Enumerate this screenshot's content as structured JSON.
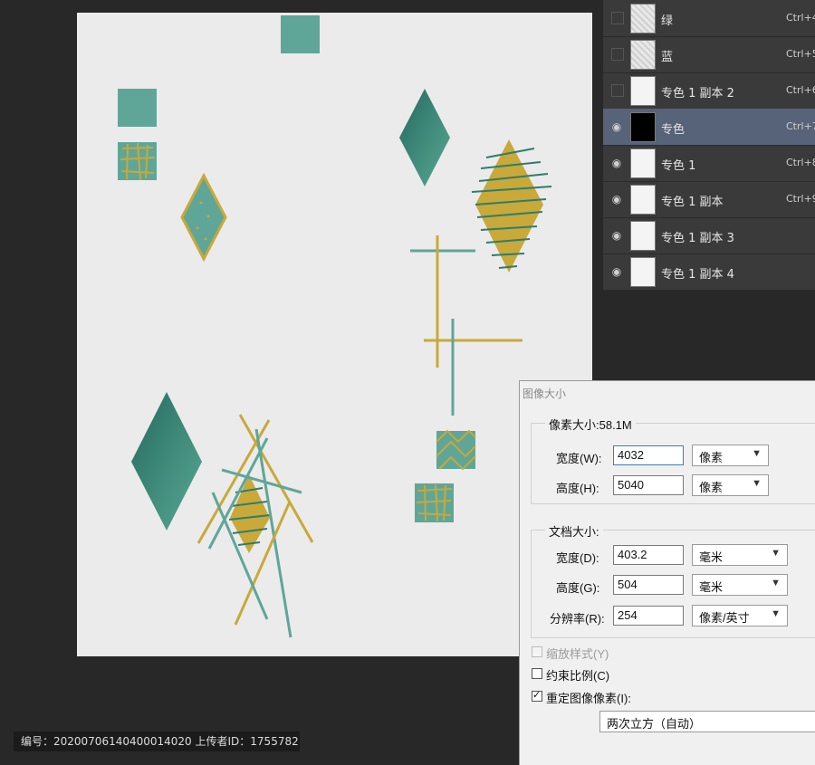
{
  "layers": [
    {
      "name": "绿",
      "shortcut": "Ctrl+4",
      "visible": false,
      "thumb": "tex"
    },
    {
      "name": "蓝",
      "shortcut": "Ctrl+5",
      "visible": false,
      "thumb": "tex"
    },
    {
      "name": "专色 1 副本 2",
      "shortcut": "Ctrl+6",
      "visible": false,
      "thumb": "white"
    },
    {
      "name": "专色",
      "shortcut": "Ctrl+7",
      "visible": true,
      "active": true,
      "thumb": "black"
    },
    {
      "name": "专色 1",
      "shortcut": "Ctrl+8",
      "visible": true,
      "thumb": "white"
    },
    {
      "name": "专色 1 副本",
      "shortcut": "Ctrl+9",
      "visible": true,
      "thumb": "white"
    },
    {
      "name": "专色 1 副本 3",
      "shortcut": "",
      "visible": true,
      "thumb": "white"
    },
    {
      "name": "专色 1 副本 4",
      "shortcut": "",
      "visible": true,
      "thumb": "white"
    }
  ],
  "dialog": {
    "title": "图像大小",
    "pixel_size_label": "像素大小:58.1M",
    "width_label": "宽度(W):",
    "width_value": "4032",
    "width_unit": "像素",
    "height_label": "高度(H):",
    "height_value": "5040",
    "height_unit": "像素",
    "doc_size_label": "文档大小:",
    "doc_width_label": "宽度(D):",
    "doc_width_value": "403.2",
    "doc_width_unit": "毫米",
    "doc_height_label": "高度(G):",
    "doc_height_value": "504",
    "doc_height_unit": "毫米",
    "resolution_label": "分辨率(R):",
    "resolution_value": "254",
    "resolution_unit": "像素/英寸",
    "scale_styles_label": "缩放样式(Y)",
    "constrain_label": "约束比例(C)",
    "resample_label": "重定图像像素(I):",
    "resample_method": "两次立方（自动）"
  },
  "footer": {
    "text": "编号：20200706140400014020 上传者ID：1755782"
  },
  "colors": {
    "teal": "#5fa698",
    "dark_teal": "#2e7d6c",
    "mustard": "#c8a93a",
    "canvas_bg": "#ebebeb",
    "app_bg": "#282828"
  }
}
